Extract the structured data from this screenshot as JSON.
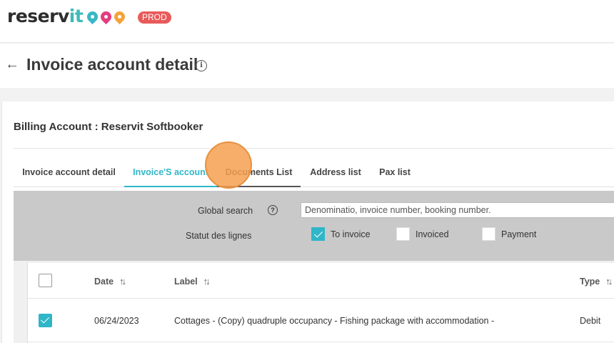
{
  "app": {
    "logo_main": "reserv",
    "logo_accent": "it",
    "env_badge": "PROD"
  },
  "header": {
    "back_icon": "arrow-left-icon",
    "title": "Invoice account detail",
    "info_icon_glyph": "i"
  },
  "billing": {
    "title": "Billing Account : Reservit Softbooker"
  },
  "tabs": [
    {
      "label": "Invoice account detail",
      "active": false
    },
    {
      "label": "Invoice'S account",
      "active": true
    },
    {
      "label": "Documents List",
      "active": false
    },
    {
      "label": "Address list",
      "active": false
    },
    {
      "label": "Pax list",
      "active": false
    }
  ],
  "filters": {
    "global_search_label": "Global search",
    "help_glyph": "?",
    "search_placeholder": "Denominatio, invoice number, booking number.",
    "status_label": "Statut des lignes",
    "checkboxes": [
      {
        "label": "To invoice",
        "checked": true
      },
      {
        "label": "Invoiced",
        "checked": false
      },
      {
        "label": "Payment",
        "checked": false
      }
    ]
  },
  "table": {
    "columns": {
      "date": "Date",
      "label": "Label",
      "type": "Type"
    },
    "sort_glyph": "↑↓",
    "rows": [
      {
        "checked": true,
        "date": "06/24/2023",
        "label": "Cottages - (Copy) quadruple occupancy - Fishing package with accommodation -",
        "type": "Debit"
      }
    ]
  },
  "colors": {
    "accent": "#2fb6c8",
    "badge": "#e85a5a",
    "filter_bg": "#c9c9c9"
  }
}
